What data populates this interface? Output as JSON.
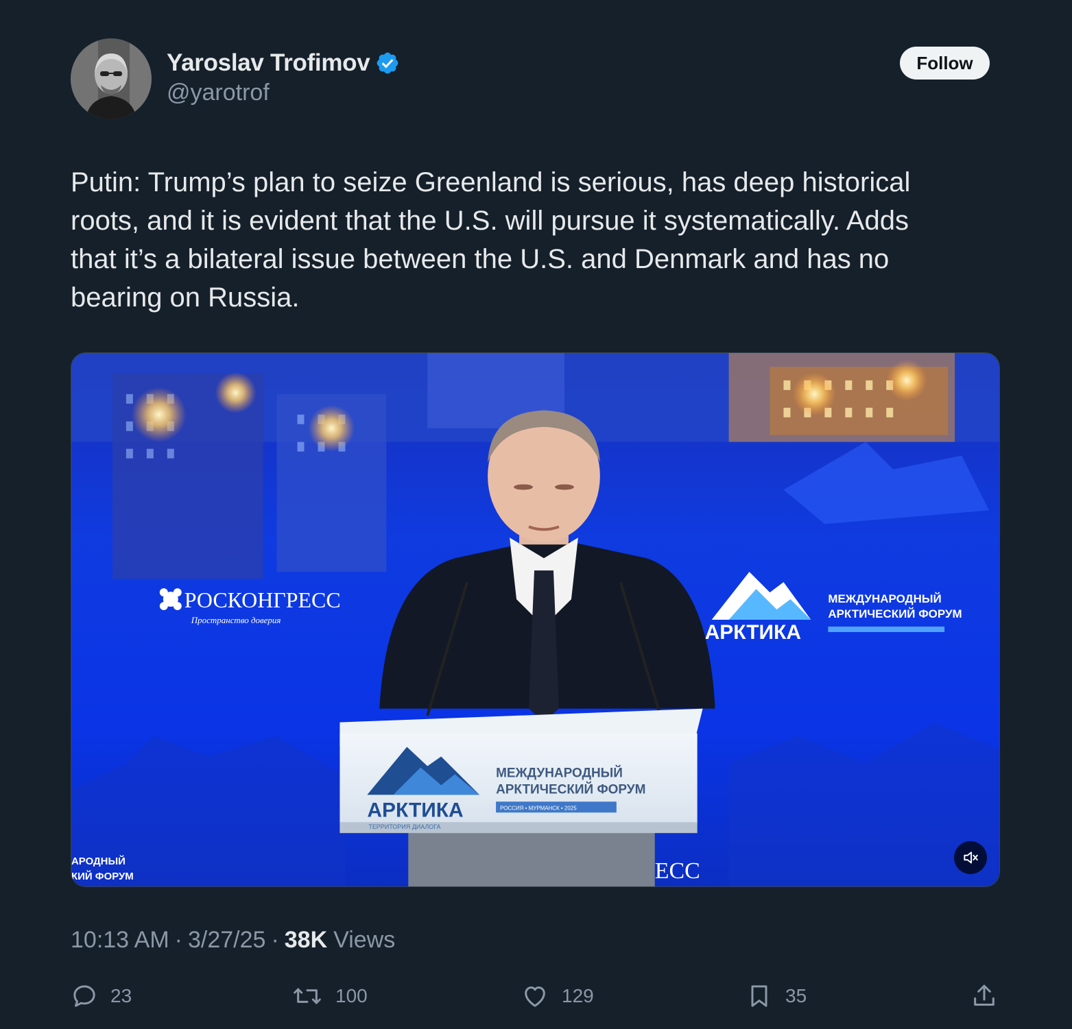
{
  "author": {
    "display_name": "Yaroslav Trofimov",
    "handle": "@yarotrof",
    "verified": true
  },
  "follow_label": "Follow",
  "tweet": {
    "text": "Putin: Trump’s plan to seize Greenland is serious, has deep historical\nroots, and it is evident that the U.S. will pursue it systematically. Adds\nthat it’s a bilateral issue between the U.S. and Denmark and has no\nbearing on Russia."
  },
  "media": {
    "left_logo_title": "РОСКОНГРЕСС",
    "left_logo_subtitle": "Пространство доверия",
    "right_logo_name": "АРКТИКА",
    "right_logo_title_line1": "МЕЖДУНАРОДНЫЙ",
    "right_logo_title_line2": "АРКТИЧЕСКИЙ ФОРУМ",
    "podium_logo_name": "АРКТИКА",
    "podium_logo_subtitle": "ТЕРРИТОРИЯ ДИАЛОГА",
    "podium_title_line1": "МЕЖДУНАРОДНЫЙ",
    "podium_title_line2": "АРКТИЧЕСКИЙ ФОРУМ",
    "podium_strip": "РОССИЯ • МУРМАНСК • 2025",
    "bottom_left_line1": "АРОДНЫЙ",
    "bottom_left_line2": "КИЙ ФОРУМ",
    "bottom_center": "ЕСС"
  },
  "meta": {
    "time": "10:13 AM",
    "date": "3/27/25",
    "views_count": "38K",
    "views_label": "Views",
    "separator": "·"
  },
  "actions": {
    "replies": "23",
    "reposts": "100",
    "likes": "129",
    "bookmarks": "35"
  },
  "colors": {
    "background": "#15202b",
    "text_primary": "#e7e9ea",
    "text_secondary": "#8b98a5",
    "verified_blue": "#1d9bf0",
    "follow_bg": "#eff3f4"
  },
  "icons": {
    "verified": "verified-badge-icon",
    "reply": "reply-icon",
    "repost": "repost-icon",
    "like": "heart-icon",
    "bookmark": "bookmark-icon",
    "share": "share-icon",
    "mute": "volume-muted-icon"
  }
}
